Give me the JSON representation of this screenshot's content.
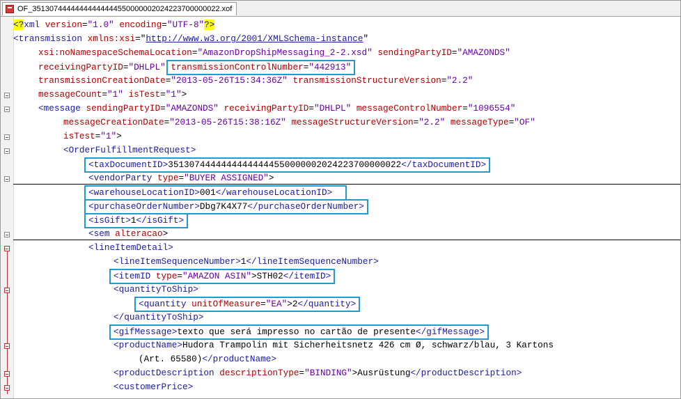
{
  "tab": {
    "filename": "OF_35130744444444444444550000002024223700000022.xof"
  },
  "xml": {
    "pi_open": "<?",
    "pi_target": "xml",
    "pi_attr1": "version",
    "pi_val1": "\"1.0\"",
    "pi_attr2": "encoding",
    "pi_val2": "\"UTF-8\"",
    "pi_close": "?>",
    "transmission_open": "<transmission",
    "xmlns_attr": "xmlns:xsi",
    "xmlns_val": "http://www.w3.org/2001/XMLSchema-instance",
    "nsloc_attr": "xsi:noNamespaceSchemaLocation",
    "nsloc_val": "\"AmazonDropShipMessaging_2-2.xsd\"",
    "sending_attr": "sendingPartyID",
    "sending_val": "\"AMAZONDS\"",
    "receiving_attr": "receivingPartyID",
    "receiving_val": "\"DHLPL\"",
    "tcn_attr": "transmissionControlNumber",
    "tcn_val": "\"442913\"",
    "tcd_attr": "transmissionCreationDate",
    "tcd_val": "\"2013-05-26T15:34:36Z\"",
    "tsv_attr": "transmissionStructureVersion",
    "tsv_val": "\"2.2\"",
    "mcount_attr": "messageCount",
    "mcount_val": "\"1\"",
    "istest_attr": "isTest",
    "istest_val": "\"1\"",
    "message_open": "<message",
    "msg_sending_val": "\"AMAZONDS\"",
    "msg_receiving_val": "\"DHLPL\"",
    "mcn_attr": "messageControlNumber",
    "mcn_val": "\"1096554\"",
    "mcd_attr": "messageCreationDate",
    "mcd_val": "\"2013-05-26T15:38:16Z\"",
    "msv_attr": "messageStructureVersion",
    "msv_val": "\"2.2\"",
    "mtype_attr": "messageType",
    "mtype_val": "\"OF\"",
    "ofr_open": "<OrderFulfillmentRequest>",
    "taxdoc_open": "<taxDocumentID>",
    "taxdoc_val": "35130744444444444444550000002024223700000022",
    "taxdoc_close": "</taxDocumentID>",
    "vendor_open": "<vendorParty",
    "vendor_attr": "type",
    "vendor_val": "\"BUYER ASSIGNED\"",
    "wh_open": "<warehouseLocationID>",
    "wh_val": "001",
    "wh_close": "</warehouseLocationID>",
    "po_open": "<purchaseOrderNumber>",
    "po_val": "Dbg7K4X77",
    "po_close": "</purchaseOrderNumber>",
    "gift_open": "<isGift>",
    "gift_val": "1",
    "gift_close": "</isGift>",
    "sem_open": "<sem",
    "sem_attr": "alteracao",
    "lid_open": "<lineItemDetail>",
    "lis_open": "<lineItemSequenceNumber>",
    "lis_val": "1",
    "lis_close": "</lineItemSequenceNumber>",
    "item_open": "<itemID",
    "item_attr": "type",
    "item_attr_val": "\"AMAZON ASIN\"",
    "item_val": "STH02",
    "item_close": "</itemID>",
    "qts_open": "<quantityToShip>",
    "qty_open": "<quantity",
    "qty_attr": "unitOfMeasure",
    "qty_attr_val": "\"EA\"",
    "qty_val": "2",
    "qty_close": "</quantity>",
    "qts_close": "</quantityToShip>",
    "gif_open": "<gifMessage>",
    "gif_val": "texto que será impresso no cartão de presente",
    "gif_close": "</gifMessage>",
    "pn_open": "<productName>",
    "pn_val1": "Hudora Trampolin mit Sicherheitsnetz 426 cm Ø, schwarz/blau, 3 Kartons",
    "pn_val2": "(Art. 65580)",
    "pn_close": "</productName>",
    "pd_open": "<productDescription",
    "pd_attr": "descriptionType",
    "pd_attr_val": "\"BINDING\"",
    "pd_val": "Ausrüstung",
    "pd_close": "</productDescription>",
    "cp_open": "<customerPrice>"
  }
}
